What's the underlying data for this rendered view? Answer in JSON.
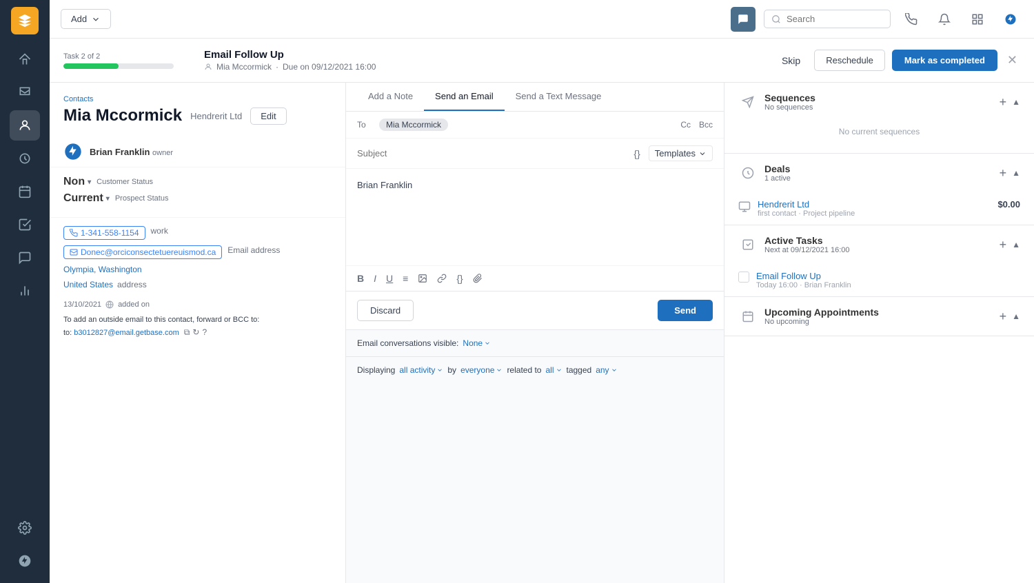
{
  "sidebar": {
    "logo_alt": "Zendesk Logo",
    "items": [
      {
        "id": "home",
        "icon": "home-icon",
        "label": "Home"
      },
      {
        "id": "inbox",
        "icon": "inbox-icon",
        "label": "Inbox"
      },
      {
        "id": "contacts",
        "icon": "contacts-icon",
        "label": "Contacts",
        "active": true
      },
      {
        "id": "deals",
        "icon": "deals-icon",
        "label": "Deals"
      },
      {
        "id": "calendar",
        "icon": "calendar-icon",
        "label": "Calendar"
      },
      {
        "id": "tasks",
        "icon": "tasks-icon",
        "label": "Tasks"
      },
      {
        "id": "chat",
        "icon": "chat-icon",
        "label": "Chat"
      },
      {
        "id": "reports",
        "icon": "reports-icon",
        "label": "Reports"
      }
    ],
    "bottom_items": [
      {
        "id": "settings",
        "icon": "settings-icon",
        "label": "Settings"
      },
      {
        "id": "zendesk",
        "icon": "zendesk-icon",
        "label": "Zendesk"
      }
    ]
  },
  "topbar": {
    "add_label": "Add",
    "search_placeholder": "Search",
    "chat_icon": "chat-icon",
    "search_icon": "search-icon",
    "phone_icon": "phone-icon",
    "bell_icon": "bell-icon",
    "grid_icon": "grid-icon",
    "zendesk_icon": "zendesk-icon"
  },
  "taskbar": {
    "task_label": "Task 2 of 2",
    "progress_pct": 50,
    "task_title": "Email Follow Up",
    "task_person": "Mia Mccormick",
    "task_due": "Due on 09/12/2021 16:00",
    "skip_label": "Skip",
    "reschedule_label": "Reschedule",
    "complete_label": "Mark as completed"
  },
  "contact": {
    "breadcrumb": "Contacts",
    "name": "Mia Mccormick",
    "company": "Hendrerit Ltd",
    "edit_label": "Edit",
    "owner_name": "Brian Franklin",
    "owner_role": "owner",
    "customer_status_value": "Non",
    "customer_status_label": "Customer Status",
    "prospect_status_value": "Current",
    "prospect_status_label": "Prospect Status",
    "phone": "1-341-558-1154",
    "phone_type": "work",
    "email": "Donec@orciconsectetuereuismod.ca",
    "email_type": "Email address",
    "city": "Olympia, Washington",
    "country": "United States",
    "location_label": "address",
    "added_date": "13/10/2021",
    "added_label": "added on",
    "bcc_note": "To add an outside email to this contact, forward or BCC to:",
    "bcc_email": "b3012827@email.getbase.com"
  },
  "email_composer": {
    "tabs": [
      {
        "id": "note",
        "label": "Add a Note"
      },
      {
        "id": "email",
        "label": "Send an Email",
        "active": true
      },
      {
        "id": "text",
        "label": "Send a Text Message"
      }
    ],
    "to_label": "To",
    "to_recipient": "Mia Mccormick",
    "cc_label": "Cc",
    "bcc_label": "Bcc",
    "subject_placeholder": "Subject",
    "templates_label": "Templates",
    "body_text": "Brian Franklin",
    "discard_label": "Discard",
    "send_label": "Send",
    "visibility_label": "Email conversations visible:",
    "visibility_value": "None",
    "displaying_label": "Displaying",
    "activity_label": "all activity",
    "by_label": "by",
    "everyone_label": "everyone",
    "related_label": "related to",
    "all_label": "all",
    "tagged_label": "tagged",
    "any_label": "any"
  },
  "right_panel": {
    "sequences": {
      "title": "Sequences",
      "sub": "No sequences",
      "empty_message": "No current sequences"
    },
    "deals": {
      "title": "Deals",
      "sub": "1 active",
      "items": [
        {
          "name": "Hendrerit Ltd",
          "meta": "first contact · Project pipeline",
          "amount": "$0.00"
        }
      ]
    },
    "active_tasks": {
      "title": "Active Tasks",
      "sub": "Next at 09/12/2021 16:00",
      "items": [
        {
          "title": "Email Follow Up",
          "meta": "Today 16:00 · Brian Franklin"
        }
      ]
    },
    "upcoming_appointments": {
      "title": "Upcoming Appointments",
      "sub": "No upcoming"
    }
  }
}
